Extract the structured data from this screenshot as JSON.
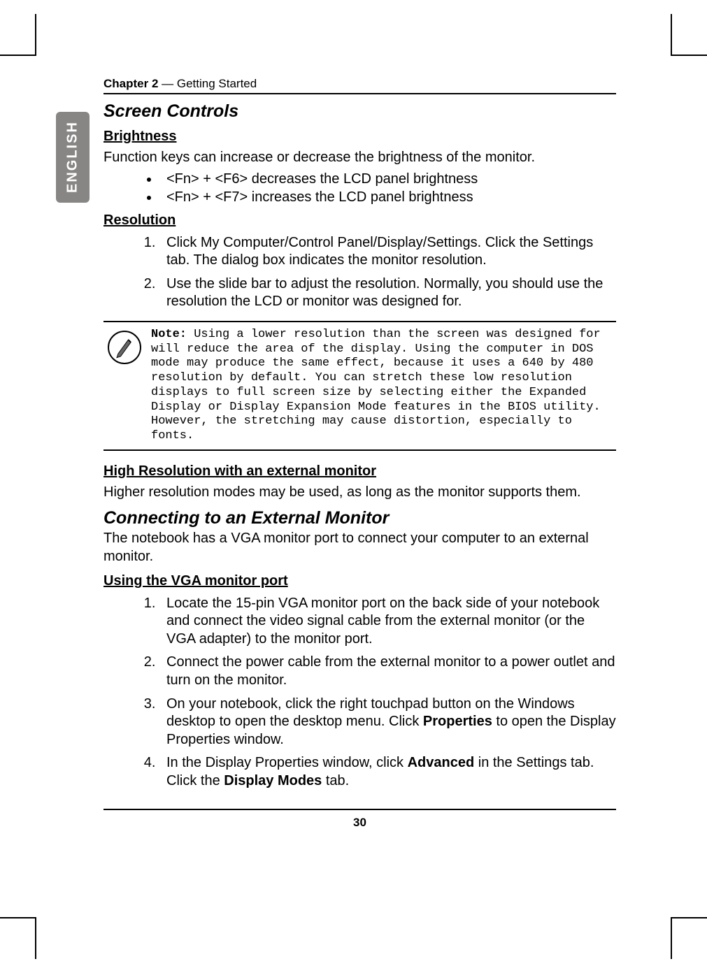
{
  "sideTab": "ENGLISH",
  "chapter": {
    "bold": "Chapter 2",
    "rest": " — Getting Started"
  },
  "section1": {
    "title": "Screen Controls",
    "brightness": {
      "heading": "Brightness",
      "intro": "Function keys can increase or decrease the brightness of the monitor.",
      "items": [
        "<Fn> + <F6> decreases the LCD panel brightness",
        "<Fn> + <F7> increases the LCD panel brightness"
      ]
    },
    "resolution": {
      "heading": "Resolution",
      "items": [
        "Click My Computer/Control Panel/Display/Settings. Click the Settings tab. The dialog box indicates the monitor resolution.",
        "Use the slide bar to adjust the resolution. Normally, you should use the resolution the LCD or monitor was designed for."
      ]
    },
    "note": {
      "label": "Note:",
      "text": " Using a lower resolution than the screen was designed for will reduce the area of the display. Using the computer in DOS mode may produce the same effect, because it uses a 640 by 480 resolution by default. You can stretch these low resolution displays to full screen size by selecting either the Expanded Display or Display Expansion Mode features in the BIOS utility. However, the stretching may cause distortion, especially to fonts."
    },
    "highRes": {
      "heading": "High Resolution with an external monitor",
      "text": "Higher resolution modes may be used, as long as the monitor supports them."
    }
  },
  "section2": {
    "title": "Connecting to an External Monitor",
    "intro": "The notebook has a VGA monitor port to connect your computer to an external monitor.",
    "vga": {
      "heading": "Using the VGA monitor port",
      "items": [
        {
          "pre": "Locate the 15-pin VGA monitor port on the back side of your notebook and connect the video signal cable from the external monitor (or the VGA adapter) to the monitor port."
        },
        {
          "pre": "Connect the power cable from the external monitor to a power outlet and turn on the monitor."
        },
        {
          "pre": "On your notebook, click the right touchpad button on the Windows desktop to open the desktop menu. Click ",
          "b1": "Properties",
          "post1": " to open the Display Properties window."
        },
        {
          "pre": "In the Display Properties window, click ",
          "b1": "Advanced",
          "post1": " in the Settings tab. Click the ",
          "b2": "Display Modes",
          "post2": " tab."
        }
      ]
    }
  },
  "pageNumber": "30"
}
